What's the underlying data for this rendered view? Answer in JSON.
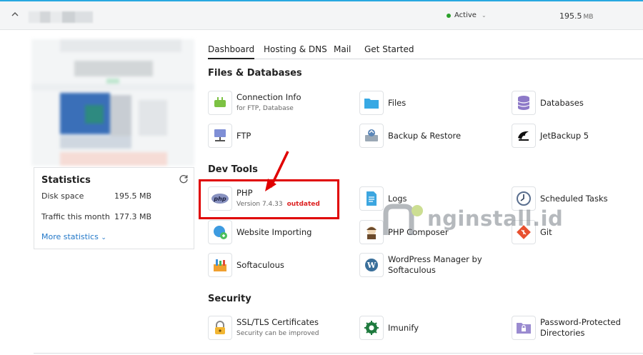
{
  "topbar": {
    "status": "Active",
    "disk_value": "195.5",
    "disk_unit": "MB"
  },
  "statistics": {
    "title": "Statistics",
    "rows": [
      {
        "label": "Disk space",
        "value": "195.5 MB"
      },
      {
        "label": "Traffic this month",
        "value": "177.3 MB"
      }
    ],
    "more": "More statistics"
  },
  "tabs": [
    "Dashboard",
    "Hosting & DNS",
    "Mail",
    "Get Started"
  ],
  "sections": {
    "files": "Files & Databases",
    "dev": "Dev Tools",
    "security": "Security"
  },
  "tiles": {
    "connection": {
      "label": "Connection Info",
      "sub": "for FTP, Database"
    },
    "files": {
      "label": "Files"
    },
    "databases": {
      "label": "Databases"
    },
    "ftp": {
      "label": "FTP"
    },
    "backup": {
      "label": "Backup & Restore"
    },
    "jetbackup": {
      "label": "JetBackup 5"
    },
    "php": {
      "label": "PHP",
      "sub": "Version 7.4.33",
      "badge": "outdated"
    },
    "logs": {
      "label": "Logs"
    },
    "scheduled": {
      "label": "Scheduled Tasks"
    },
    "importing": {
      "label": "Website Importing"
    },
    "composer": {
      "label": "PHP Composer"
    },
    "git": {
      "label": "Git"
    },
    "softaculous": {
      "label": "Softaculous"
    },
    "wordpress": {
      "label": "WordPress Manager by",
      "label2": "Softaculous"
    },
    "ssl": {
      "label": "SSL/TLS Certificates",
      "sub": "Security can be improved"
    },
    "imunify": {
      "label": "Imunify"
    },
    "password": {
      "label": "Password-Protected",
      "label2": "Directories"
    }
  },
  "watermark": "nginstall.id",
  "colors": {
    "accent": "#28a8e0",
    "link": "#2378c8",
    "status_green": "#2aa02a",
    "highlight": "#e00000",
    "badge": "#dd2222"
  },
  "icons": [
    "chevron-up-icon",
    "refresh-icon",
    "chevron-down-icon",
    "plug-icon",
    "folder-icon",
    "database-icon",
    "ftp-icon",
    "backup-icon",
    "jetbackup-icon",
    "php-icon",
    "logs-icon",
    "clock-icon",
    "globe-import-icon",
    "composer-icon",
    "git-icon",
    "softaculous-icon",
    "wordpress-icon",
    "lock-icon",
    "shield-gear-icon",
    "folder-lock-icon"
  ]
}
